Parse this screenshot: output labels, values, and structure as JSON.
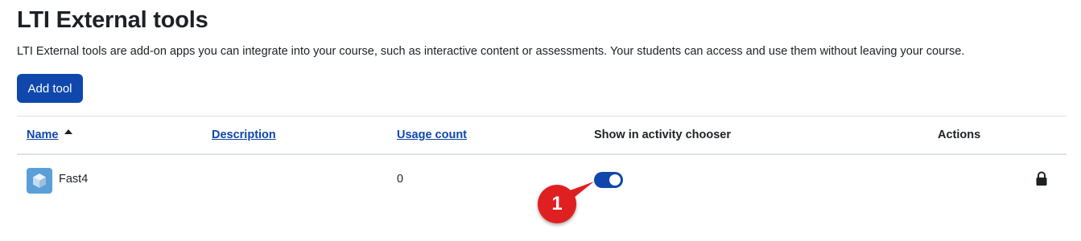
{
  "page": {
    "title": "LTI External tools",
    "intro": "LTI External tools are add-on apps you can integrate into your course, such as interactive content or assessments. Your students can access and use them without leaving your course.",
    "add_tool_label": "Add tool"
  },
  "table": {
    "headers": {
      "name": "Name",
      "description": "Description",
      "usage_count": "Usage count",
      "show_in_chooser": "Show in activity chooser",
      "actions": "Actions"
    },
    "sort": {
      "column": "name",
      "direction": "ascending"
    },
    "rows": [
      {
        "name": "Fast4",
        "description": "",
        "usage_count": "0",
        "show_in_chooser": true,
        "icon": "cube-icon",
        "action_icon": "lock-icon"
      }
    ]
  },
  "annotation": {
    "label": "1",
    "color": "#e02020"
  },
  "colors": {
    "accent": "#0f47ad",
    "text": "#1d2125",
    "border": "#dee2e6"
  }
}
